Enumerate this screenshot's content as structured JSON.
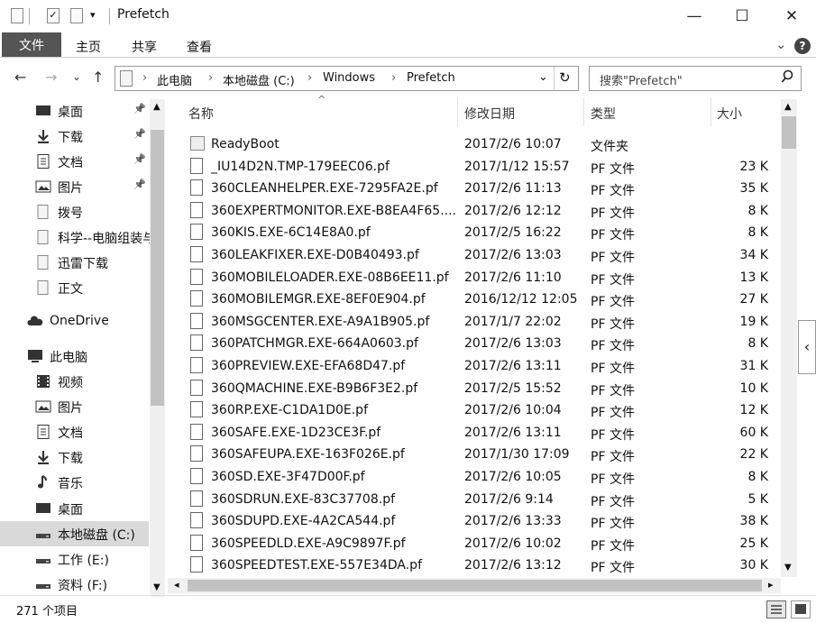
{
  "window": {
    "title": "Prefetch",
    "minimize": "—",
    "maximize": "☐",
    "close": "✕"
  },
  "ribbon": {
    "tabs": [
      "文件",
      "主页",
      "共享",
      "查看"
    ],
    "expand": "⌄",
    "help": "?"
  },
  "address": {
    "crumbs": [
      "此电脑",
      "本地磁盘 (C:)",
      "Windows",
      "Prefetch"
    ],
    "search_placeholder": "搜索\"Prefetch\""
  },
  "nav": {
    "back": "←",
    "forward": "→",
    "down": "⌄",
    "up": "↑",
    "refresh": "↻"
  },
  "tree": [
    {
      "label": "桌面",
      "icon": "desktop-icon",
      "pinned": true
    },
    {
      "label": "下载",
      "icon": "download-icon",
      "pinned": true
    },
    {
      "label": "文档",
      "icon": "document-icon",
      "pinned": true
    },
    {
      "label": "图片",
      "icon": "picture-icon",
      "pinned": true
    },
    {
      "label": "拨号",
      "icon": "folder-icon",
      "pinned": false
    },
    {
      "label": "科学--电脑组装与",
      "icon": "folder-icon",
      "pinned": false
    },
    {
      "label": "迅雷下载",
      "icon": "folder-icon",
      "pinned": false
    },
    {
      "label": "正文",
      "icon": "folder-icon",
      "pinned": false
    },
    {
      "label": "OneDrive",
      "icon": "cloud-icon",
      "pinned": false
    },
    {
      "label": "此电脑",
      "icon": "computer-icon",
      "pinned": false
    },
    {
      "label": "视频",
      "icon": "video-icon",
      "pinned": false
    },
    {
      "label": "图片",
      "icon": "picture-icon",
      "pinned": false
    },
    {
      "label": "文档",
      "icon": "document-icon",
      "pinned": false
    },
    {
      "label": "下载",
      "icon": "download-icon",
      "pinned": false
    },
    {
      "label": "音乐",
      "icon": "music-icon",
      "pinned": false
    },
    {
      "label": "桌面",
      "icon": "desktop-icon",
      "pinned": false
    },
    {
      "label": "本地磁盘 (C:)",
      "icon": "drive-icon",
      "pinned": false,
      "selected": true
    },
    {
      "label": "工作 (E:)",
      "icon": "drive-icon",
      "pinned": false
    },
    {
      "label": "资料 (F:)",
      "icon": "drive-icon",
      "pinned": false
    }
  ],
  "columns": {
    "name": "名称",
    "date": "修改日期",
    "type": "类型",
    "size": "大小"
  },
  "files": [
    {
      "name": "ReadyBoot",
      "date": "2017/2/6 10:07",
      "type": "文件夹",
      "size": "",
      "folder": true
    },
    {
      "name": "_IU14D2N.TMP-179EEC06.pf",
      "date": "2017/1/12 15:57",
      "type": "PF 文件",
      "size": "23 K"
    },
    {
      "name": "360CLEANHELPER.EXE-7295FA2E.pf",
      "date": "2017/2/6 11:13",
      "type": "PF 文件",
      "size": "35 K"
    },
    {
      "name": "360EXPERTMONITOR.EXE-B8EA4F65....",
      "date": "2017/2/6 12:12",
      "type": "PF 文件",
      "size": "8 K"
    },
    {
      "name": "360KIS.EXE-6C14E8A0.pf",
      "date": "2017/2/5 16:22",
      "type": "PF 文件",
      "size": "8 K"
    },
    {
      "name": "360LEAKFIXER.EXE-D0B40493.pf",
      "date": "2017/2/6 13:03",
      "type": "PF 文件",
      "size": "34 K"
    },
    {
      "name": "360MOBILELOADER.EXE-08B6EE11.pf",
      "date": "2017/2/6 11:10",
      "type": "PF 文件",
      "size": "13 K"
    },
    {
      "name": "360MOBILEMGR.EXE-8EF0E904.pf",
      "date": "2016/12/12 12:05",
      "type": "PF 文件",
      "size": "27 K"
    },
    {
      "name": "360MSGCENTER.EXE-A9A1B905.pf",
      "date": "2017/1/7 22:02",
      "type": "PF 文件",
      "size": "19 K"
    },
    {
      "name": "360PATCHMGR.EXE-664A0603.pf",
      "date": "2017/2/6 13:03",
      "type": "PF 文件",
      "size": "8 K"
    },
    {
      "name": "360PREVIEW.EXE-EFA68D47.pf",
      "date": "2017/2/6 13:11",
      "type": "PF 文件",
      "size": "31 K"
    },
    {
      "name": "360QMACHINE.EXE-B9B6F3E2.pf",
      "date": "2017/2/5 15:52",
      "type": "PF 文件",
      "size": "10 K"
    },
    {
      "name": "360RP.EXE-C1DA1D0E.pf",
      "date": "2017/2/6 10:04",
      "type": "PF 文件",
      "size": "12 K"
    },
    {
      "name": "360SAFE.EXE-1D23CE3F.pf",
      "date": "2017/2/6 13:11",
      "type": "PF 文件",
      "size": "60 K"
    },
    {
      "name": "360SAFEUPA.EXE-163F026E.pf",
      "date": "2017/1/30 17:09",
      "type": "PF 文件",
      "size": "22 K"
    },
    {
      "name": "360SD.EXE-3F47D00F.pf",
      "date": "2017/2/6 10:05",
      "type": "PF 文件",
      "size": "8 K"
    },
    {
      "name": "360SDRUN.EXE-83C37708.pf",
      "date": "2017/2/6 9:14",
      "type": "PF 文件",
      "size": "5 K"
    },
    {
      "name": "360SDUPD.EXE-4A2CA544.pf",
      "date": "2017/2/6 13:33",
      "type": "PF 文件",
      "size": "38 K"
    },
    {
      "name": "360SPEEDLD.EXE-A9C9897F.pf",
      "date": "2017/2/6 10:02",
      "type": "PF 文件",
      "size": "25 K"
    },
    {
      "name": "360SPEEDTEST.EXE-557E34DA.pf",
      "date": "2017/2/6 13:12",
      "type": "PF 文件",
      "size": "30 K"
    }
  ],
  "status": {
    "count": "271 个项目"
  }
}
